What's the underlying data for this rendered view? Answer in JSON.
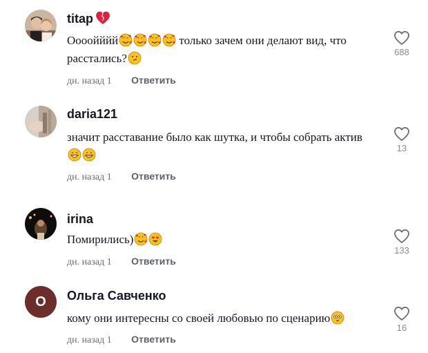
{
  "comments": [
    {
      "username": "titap",
      "username_emoji": "broken-heart-icon",
      "text_prefix": "Оооойййй",
      "text_main": " только зачем они делают вид, что расстались?",
      "time": "дн. назад 1",
      "reply": "Ответить",
      "likes": "688"
    },
    {
      "username": "daria121",
      "text_main": "значит расставание было как шутка, и чтобы собрать актив ",
      "time": "дн. назад 1",
      "reply": "Ответить",
      "likes": "13"
    },
    {
      "username": "irina",
      "text_main": "Помирились)",
      "time": "дн. назад 1",
      "reply": "Ответить",
      "likes": "133"
    },
    {
      "username": "Ольга Савченко",
      "avatar_letter": "O",
      "text_main": "кому они интересны со своей любовью по сценарию",
      "time": "дн. назад 1",
      "reply": "Ответить",
      "likes": "16"
    }
  ],
  "colors": {
    "text": "#161823",
    "muted": "#6b6d74",
    "heart_red": "#e3203b",
    "emoji_yellow": "#fcc21b",
    "avatar_letter_bg": "#6b2e2a"
  }
}
